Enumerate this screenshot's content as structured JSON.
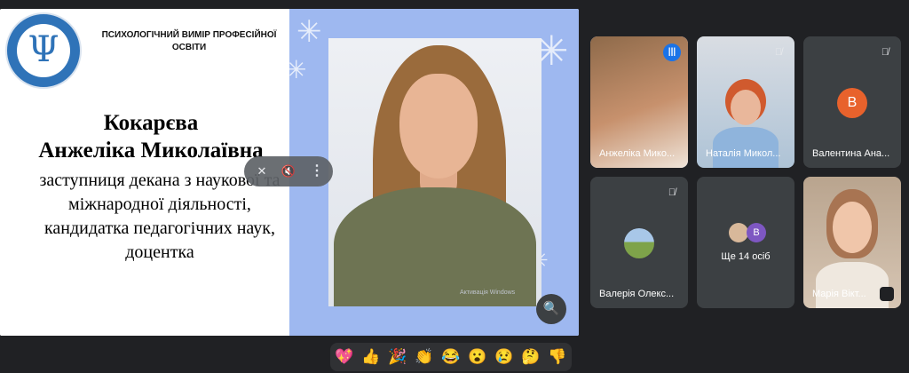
{
  "slide": {
    "header": "ПСИХОЛОГІЧНИЙ ВИМІР ПРОФЕСІЙНОЇ ОСВІТИ",
    "logo": {
      "symbol": "Ψ"
    },
    "name_line1": "Кокарєва",
    "name_line2": "Анжеліка Миколаївна",
    "role": "заступниця декана з наукової та міжнародної діяльності, кандидатка педагогічних наук, доцентка",
    "watermark": "Активація Windows"
  },
  "overlay": {
    "icons": [
      "pin-off-icon",
      "volume-off-icon",
      "more-vert-icon"
    ],
    "pin": "✕",
    "mute": "🔇",
    "more": "⋮"
  },
  "zoom": {
    "icon": "🔍"
  },
  "participants": [
    {
      "name": "Анжеліка Мико...",
      "state": "speaking",
      "active": true
    },
    {
      "name": "Наталія Микол...",
      "state": "muted"
    },
    {
      "name": "Валентина Ана...",
      "state": "muted",
      "initial": "В",
      "color": "#e8622c"
    },
    {
      "name": "Валерія Олекс...",
      "state": "muted"
    },
    {
      "more_label": "Ще 14 осіб",
      "initial": "В",
      "color": "#7e57c2"
    },
    {
      "name": "Марія Вікт...",
      "state": "framed"
    }
  ],
  "reactions": [
    "💖",
    "👍",
    "🎉",
    "👏",
    "😂",
    "😮",
    "😢",
    "🤔",
    "👎"
  ],
  "colors": {
    "background": "#202124",
    "tile": "#3c4043",
    "accent": "#8ab4f8",
    "slide_right": "#9eb8f0"
  }
}
